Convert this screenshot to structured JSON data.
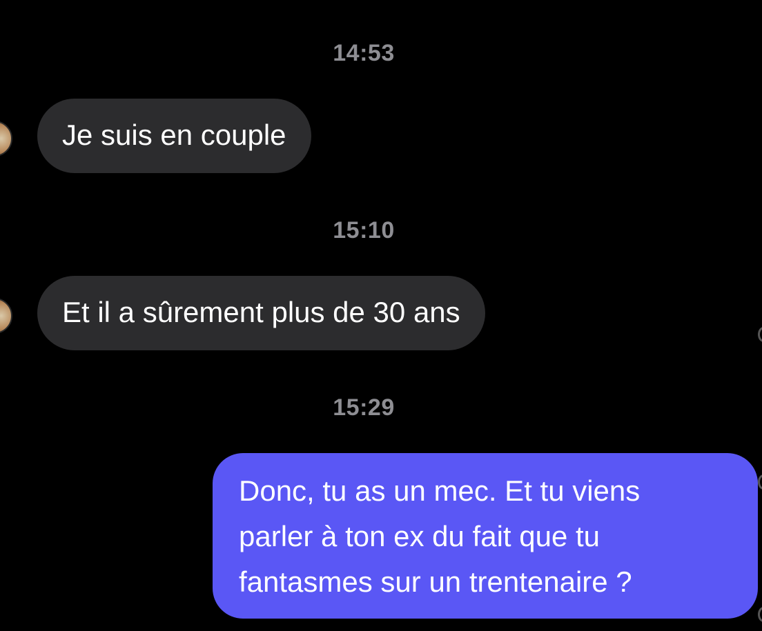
{
  "conversation": {
    "messages": [
      {
        "time": "14:53",
        "direction": "incoming",
        "text": "Je suis en couple"
      },
      {
        "time": "15:10",
        "direction": "incoming",
        "text": "Et il a sûrement plus de 30 ans"
      },
      {
        "time": "15:29",
        "direction": "outgoing",
        "lines": [
          "Donc, tu as un mec. Et tu viens",
          "parler à ton ex du fait que tu",
          "fantasmes sur un trentenaire ?"
        ]
      }
    ]
  },
  "colors": {
    "background": "#000000",
    "incoming_bubble": "#2c2c2e",
    "outgoing_bubble": "#5a57f5",
    "timestamp": "#8e8e93"
  }
}
